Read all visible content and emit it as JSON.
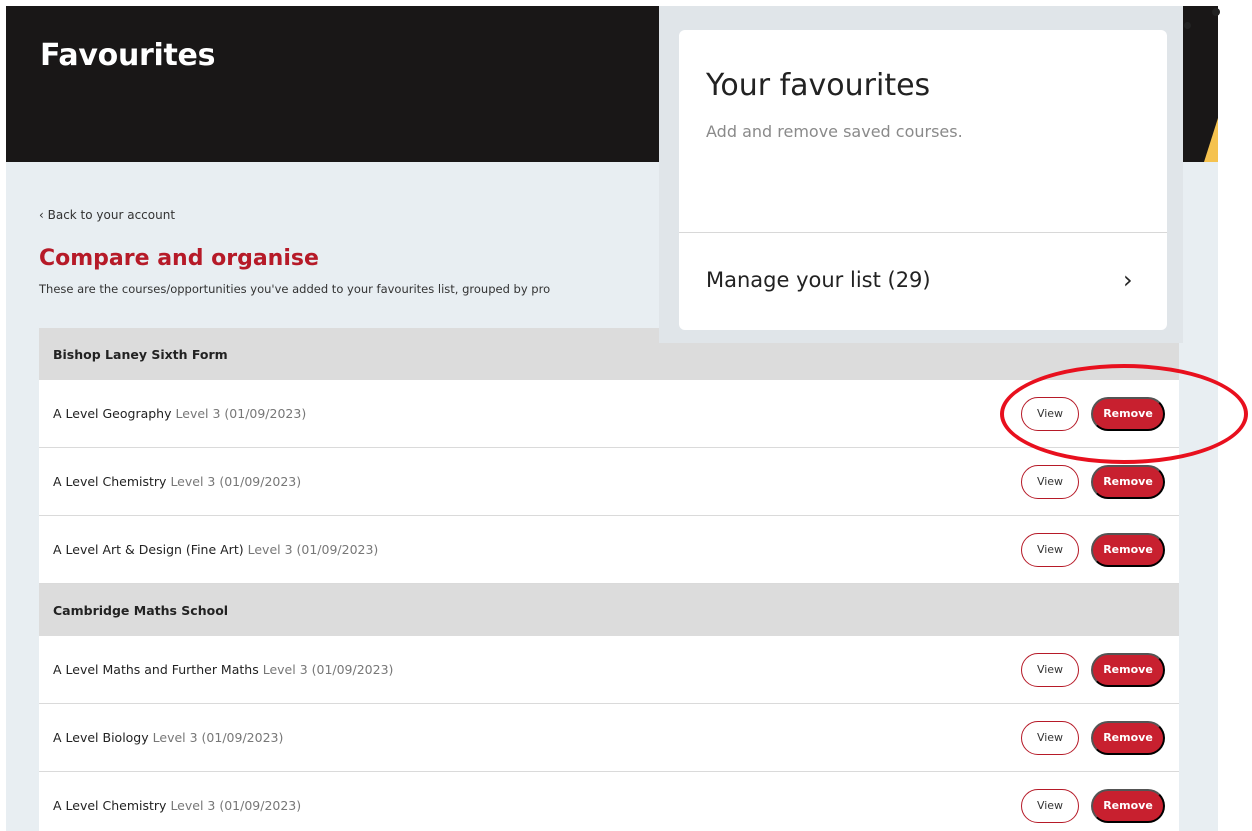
{
  "hero": {
    "title": "Favourites"
  },
  "nav": {
    "back_link": "‹ Back to your account"
  },
  "compare": {
    "title": "Compare and organise",
    "description": "These are the courses/opportunities you've added to your favourites list, grouped by pro"
  },
  "buttons": {
    "view": "View",
    "remove": "Remove"
  },
  "groups": [
    {
      "name": "Bishop Laney Sixth Form",
      "items": [
        {
          "course": "A Level Geography",
          "level": "Level 3 (01/09/2023)"
        },
        {
          "course": "A Level Chemistry",
          "level": "Level 3 (01/09/2023)"
        },
        {
          "course": "A Level Art & Design (Fine Art)",
          "level": "Level 3 (01/09/2023)"
        }
      ]
    },
    {
      "name": "Cambridge Maths School",
      "items": [
        {
          "course": "A Level Maths and Further Maths",
          "level": "Level 3 (01/09/2023)"
        },
        {
          "course": "A Level Biology",
          "level": "Level 3 (01/09/2023)"
        },
        {
          "course": "A Level Chemistry",
          "level": "Level 3 (01/09/2023)"
        }
      ]
    }
  ],
  "favourites_card": {
    "title": "Your favourites",
    "subtitle": "Add and remove saved courses.",
    "manage_label": "Manage your list (29)",
    "chevron": "chevron-right-icon"
  },
  "colors": {
    "brand_red": "#c8202f",
    "title_red": "#b61a28",
    "annotation_red": "#e8101e",
    "hero_bg": "#191717"
  }
}
